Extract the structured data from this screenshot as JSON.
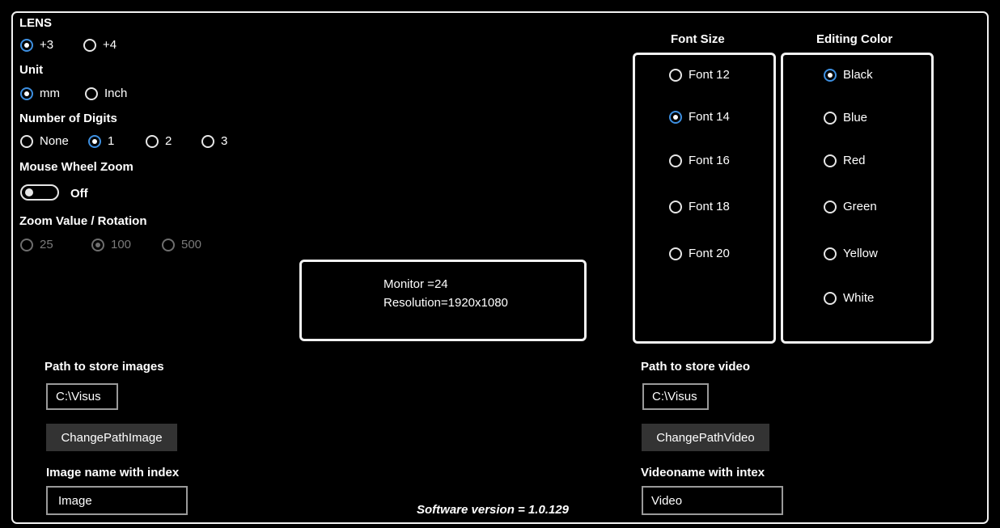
{
  "lens": {
    "heading": "LENS",
    "options": [
      "+3",
      "+4"
    ],
    "selected": "+3"
  },
  "unit": {
    "heading": "Unit",
    "options": [
      "mm",
      "Inch"
    ],
    "selected": "mm"
  },
  "digits": {
    "heading": "Number of Digits",
    "options": [
      "None",
      "1",
      "2",
      "3"
    ],
    "selected": "1"
  },
  "mouse_wheel": {
    "heading": "Mouse Wheel Zoom",
    "state": "Off"
  },
  "zoom": {
    "heading": "Zoom Value / Rotation",
    "options": [
      "25",
      "100",
      "500"
    ],
    "selected": "100",
    "disabled": true
  },
  "monitor_info": {
    "monitor": "Monitor =24",
    "resolution": "Resolution=1920x1080"
  },
  "font_size": {
    "heading": "Font Size",
    "options": [
      "Font 12",
      "Font 14",
      "Font 16",
      "Font 18",
      "Font 20"
    ],
    "selected": "Font 14"
  },
  "editing_color": {
    "heading": "Editing Color",
    "options": [
      "Black",
      "Blue",
      "Red",
      "Green",
      "Yellow",
      "White"
    ],
    "selected": "Black"
  },
  "images": {
    "path_label": "Path to store images",
    "path_value": "C:\\Visus",
    "change_button": "ChangePathImage",
    "name_label": "Image name with index",
    "name_value": "Image"
  },
  "video": {
    "path_label": "Path to store video",
    "path_value": "C:\\Visus",
    "change_button": "ChangePathVideo",
    "name_label": "Videoname with intex",
    "name_value": "Video"
  },
  "version_text": "Software version = 1.0.129",
  "colors": {
    "background": "#000000",
    "accent": "#3d8fe0",
    "border": "#f2f2f2",
    "button_bg": "#333333"
  }
}
